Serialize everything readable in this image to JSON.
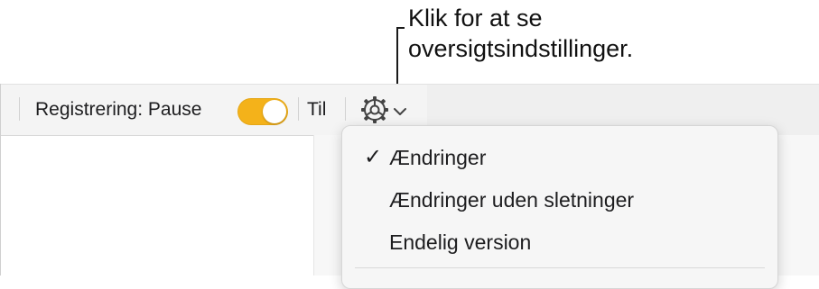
{
  "callout": {
    "line1": "Klik for at se",
    "line2": "oversigtsindstillinger."
  },
  "toolbar": {
    "tracking_label": "Registrering: Pause",
    "tracking_toggle_on": true,
    "toggle_color": "#f4b21a",
    "status_label": "Til",
    "view_options_icon": "gear-icon"
  },
  "menu": {
    "items": [
      {
        "label": "Ændringer",
        "checked": true,
        "check_glyph": "✓"
      },
      {
        "label": "Ændringer uden sletninger",
        "checked": false,
        "check_glyph": ""
      },
      {
        "label": "Endelig version",
        "checked": false,
        "check_glyph": ""
      }
    ]
  }
}
